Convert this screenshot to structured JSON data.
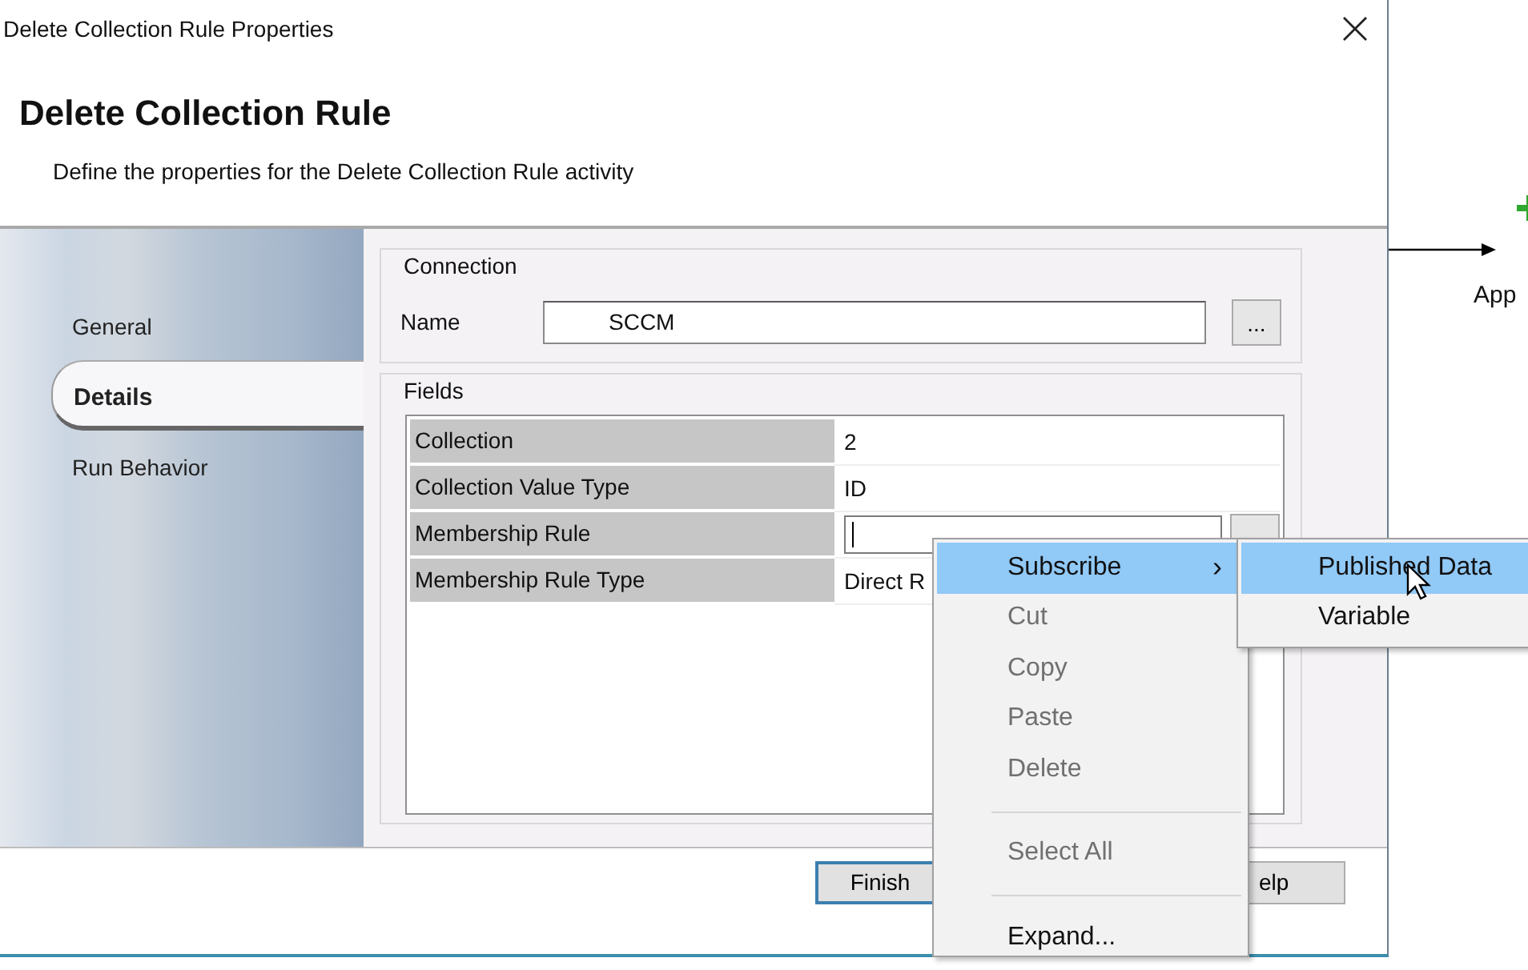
{
  "window": {
    "title": "Delete Collection Rule Properties"
  },
  "header": {
    "title": "Delete Collection Rule",
    "subtitle": "Define the properties for the Delete Collection Rule activity"
  },
  "tabs": [
    {
      "label": "General",
      "selected": false
    },
    {
      "label": "Details",
      "selected": true
    },
    {
      "label": "Run Behavior",
      "selected": false
    }
  ],
  "connection": {
    "legend": "Connection",
    "name_label": "Name",
    "name_value": "SCCM",
    "browse_label": "..."
  },
  "fields": {
    "legend": "Fields",
    "rows": [
      {
        "label": "Collection",
        "value": "2",
        "kind": "text"
      },
      {
        "label": "Collection Value Type",
        "value": "ID",
        "kind": "text"
      },
      {
        "label": "Membership Rule",
        "kind": "input"
      },
      {
        "label": "Membership Rule Type",
        "value": "Direct R",
        "kind": "text"
      }
    ]
  },
  "buttons": [
    {
      "label": "Finish",
      "kind": "default"
    },
    {
      "label": "elp",
      "kind": "plain"
    }
  ],
  "context_menu": {
    "items": [
      {
        "kind": "submenu",
        "label": "Subscribe",
        "arrow": "›",
        "selected": true,
        "disabled": false
      },
      {
        "kind": "item",
        "label": "Cut",
        "selected": false,
        "disabled": true
      },
      {
        "kind": "item",
        "label": "Copy",
        "selected": false,
        "disabled": true
      },
      {
        "kind": "item",
        "label": "Paste",
        "selected": false,
        "disabled": true
      },
      {
        "kind": "item",
        "label": "Delete",
        "selected": false,
        "disabled": true
      },
      {
        "kind": "separator"
      },
      {
        "kind": "item",
        "label": "Select All",
        "selected": false,
        "disabled": true
      },
      {
        "kind": "separator"
      },
      {
        "kind": "item",
        "label": "Expand...",
        "selected": false,
        "disabled": false
      }
    ],
    "submenu": [
      {
        "label": "Published Data",
        "selected": true
      },
      {
        "label": "Variable",
        "selected": false
      }
    ]
  },
  "canvas": {
    "label": "App"
  }
}
